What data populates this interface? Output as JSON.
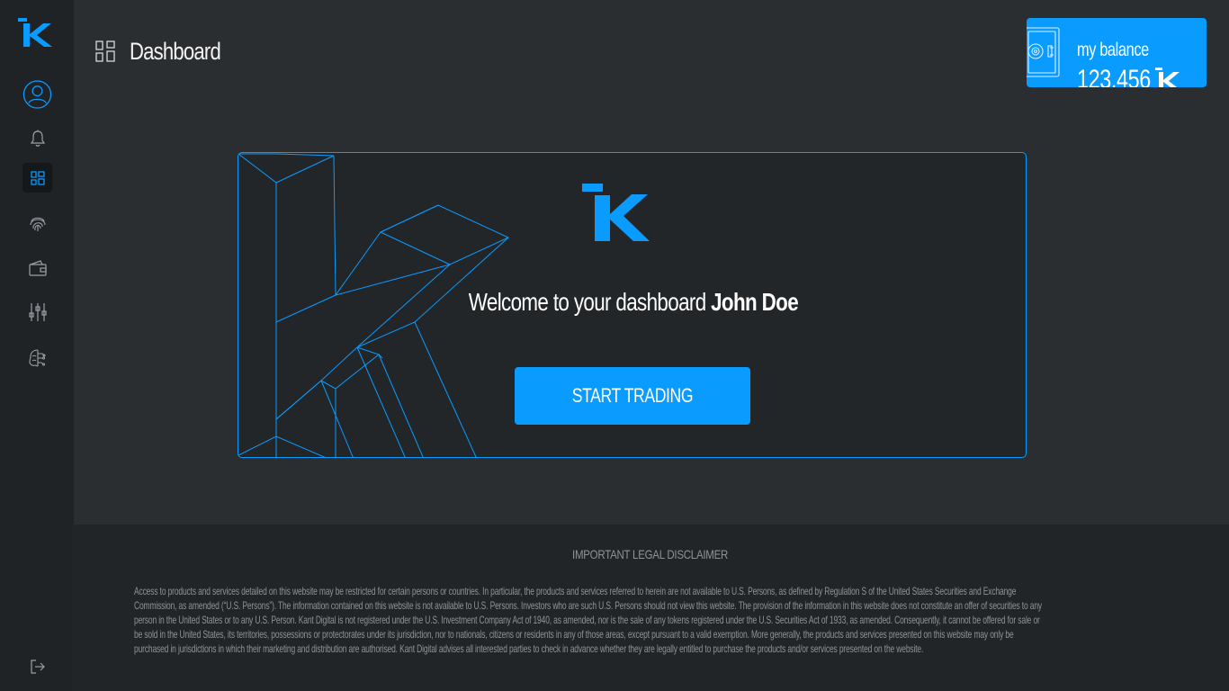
{
  "header": {
    "title": "Dashboard"
  },
  "sidebar": {
    "items": [
      {
        "name": "profile-icon"
      },
      {
        "name": "bell-icon"
      },
      {
        "name": "dashboard-icon",
        "active": true
      },
      {
        "name": "fingerprint-icon"
      },
      {
        "name": "wallet-icon"
      },
      {
        "name": "sliders-icon"
      },
      {
        "name": "brain-icon"
      }
    ],
    "logout_icon": "logout-icon"
  },
  "balance": {
    "label": "my balance",
    "value": "123.456",
    "icon": "safe-icon"
  },
  "hero": {
    "welcome_prefix": "Welcome to your dashboard ",
    "user_name": "John Doe",
    "button_label": "START TRADING"
  },
  "footer": {
    "disclaimer_title": "IMPORTANT LEGAL DISCLAIMER",
    "disclaimer_lines": [
      "Access to products and services detailed on this website may be restricted for certain persons or countries. In particular, the products and services referred to herein are not available to U.S. Persons, as defined by Regulation S of the United States Securities and Exchange",
      "Commission, as amended (“U.S. Persons”). The information contained on this website is not available to U.S. Persons. Investors who are such U.S. Persons should not view this website. The provision of the information in this website does not constitute an offer of securities to any",
      "person in the United States or to any U.S. Person. Kant Digital is not registered under the U.S. Investment Company Act of 1940, as amended, nor is the sale of any tokens registered under the U.S. Securities Act of 1933, as amended. Consequently, it cannot be offered for sale or",
      "be sold in the United States, its territories, possessions or protectorates under its jurisdiction, nor to nationals, citizens or residents in any of those areas, except pursuant to a valid exemption. More generally, the products and services presented on this website may only be",
      "purchased in jurisdictions in which their marketing and distribution are authorised. Kant Digital advises all interested parties to check in advance whether they are legally entitled to purchase the products and/or services presented on the website."
    ]
  },
  "colors": {
    "accent": "#0a9bff",
    "background": "#2b2e31",
    "sidebar": "#202326",
    "footer": "#222527",
    "muted_text": "#8f9397"
  }
}
